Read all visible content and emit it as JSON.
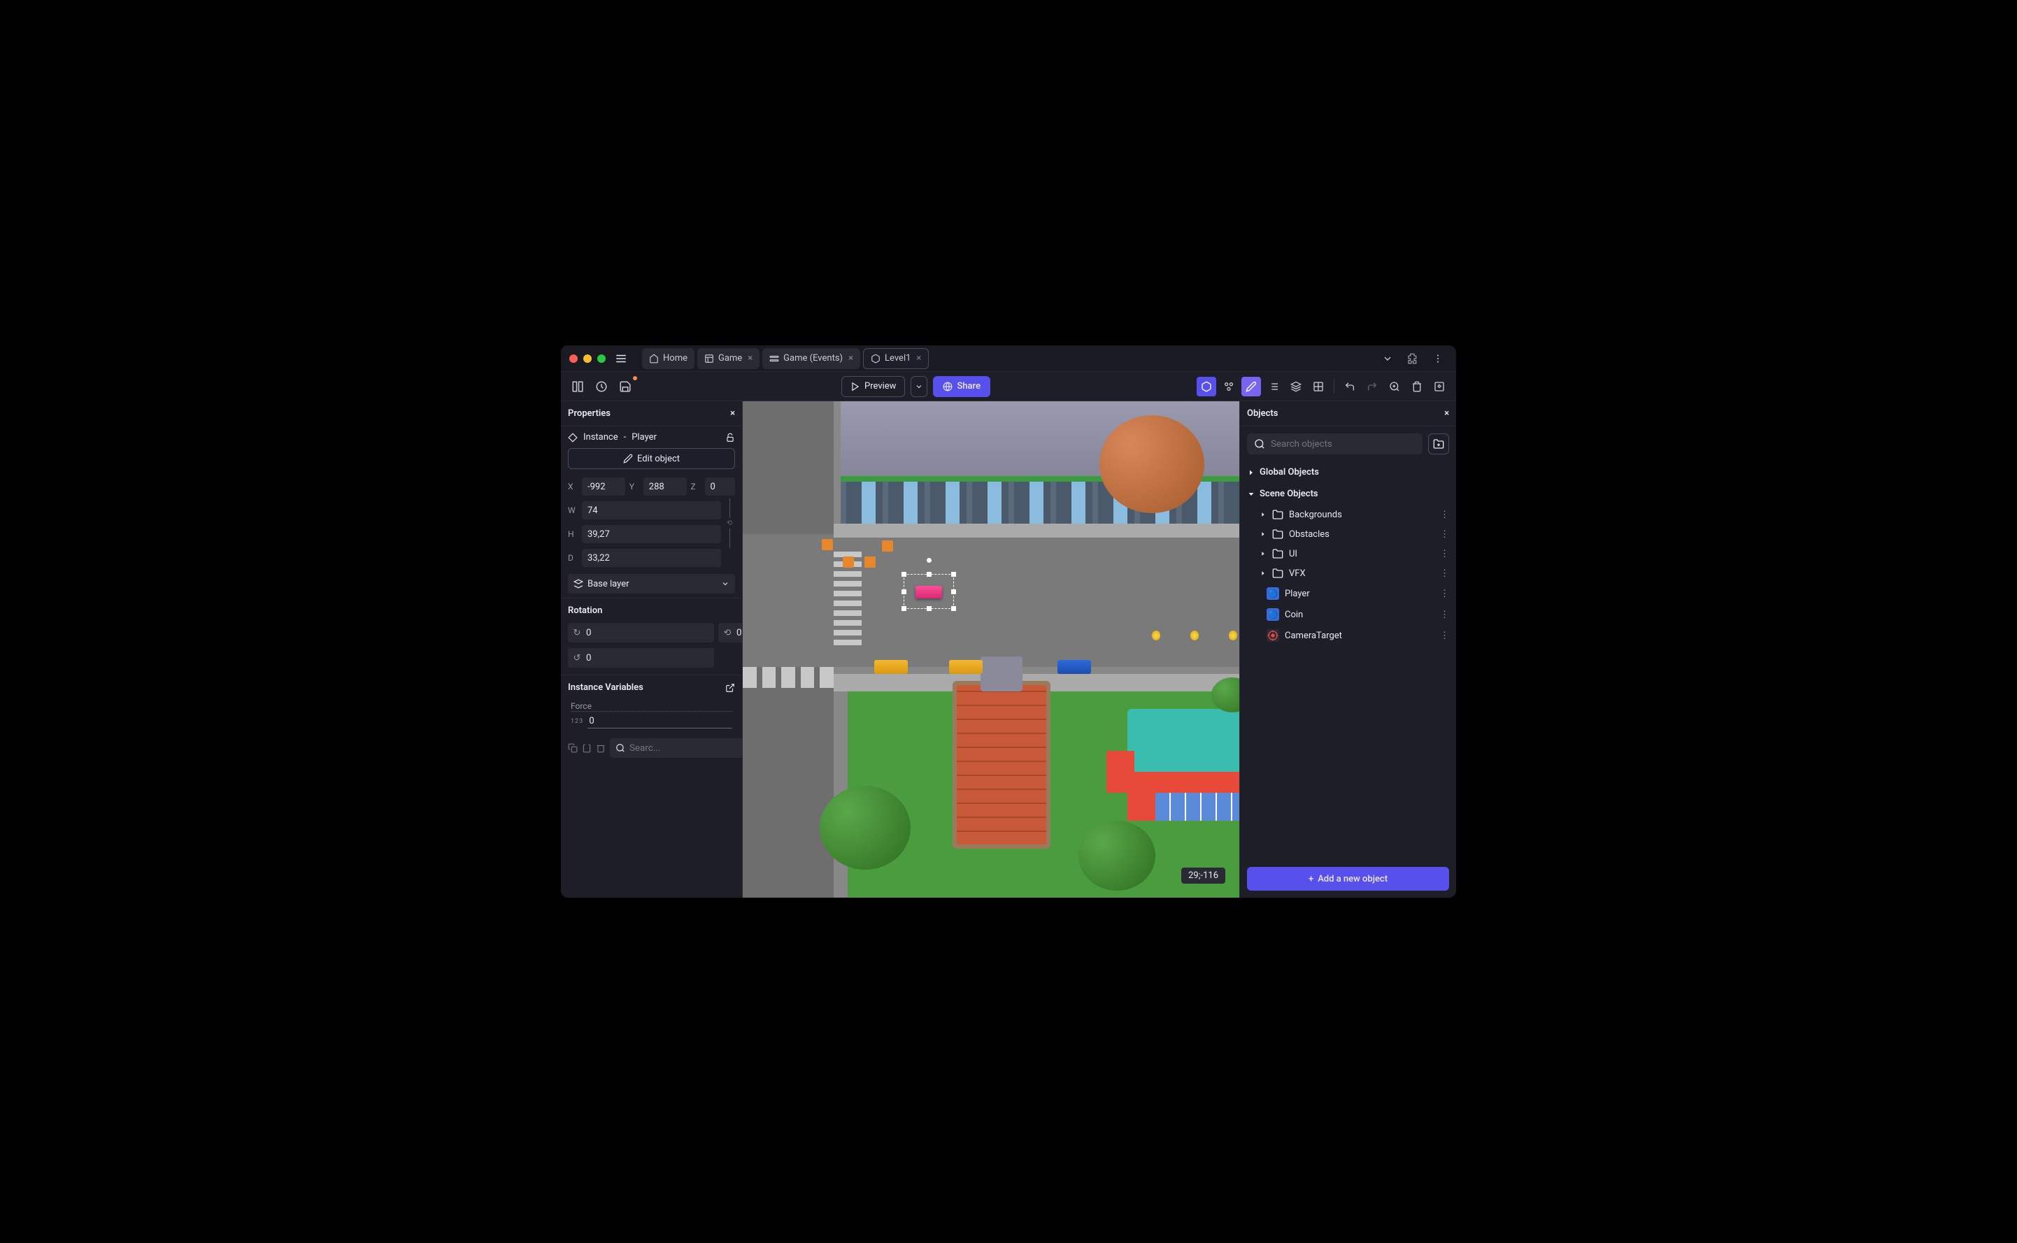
{
  "tabs": [
    {
      "label": "Home",
      "icon": "home"
    },
    {
      "label": "Game",
      "icon": "sheet",
      "closable": true
    },
    {
      "label": "Game (Events)",
      "icon": "events",
      "closable": true
    },
    {
      "label": "Level1",
      "icon": "scene",
      "closable": true,
      "active": true
    }
  ],
  "toolbar": {
    "preview_label": "Preview",
    "share_label": "Share"
  },
  "properties": {
    "panel_title": "Properties",
    "instance_label": "Instance",
    "instance_sep": "-",
    "instance_name": "Player",
    "edit_object_label": "Edit object",
    "x_label": "X",
    "x_value": "-992",
    "y_label": "Y",
    "y_value": "288",
    "z_label": "Z",
    "z_value": "0",
    "w_label": "W",
    "w_value": "74",
    "h_label": "H",
    "h_value": "39,27",
    "d_label": "D",
    "d_value": "33,22",
    "layer_label": "Base layer",
    "rotation_title": "Rotation",
    "rot_x": "0",
    "rot_y": "0",
    "rot_z": "0",
    "vars_title": "Instance Variables",
    "force_label": "Force",
    "force_type": "123",
    "force_value": "0",
    "search_placeholder": "Searc..."
  },
  "objects": {
    "panel_title": "Objects",
    "search_placeholder": "Search objects",
    "global_header": "Global Objects",
    "scene_header": "Scene Objects",
    "folders": [
      {
        "name": "Backgrounds"
      },
      {
        "name": "Obstacles"
      },
      {
        "name": "UI"
      },
      {
        "name": "VFX"
      }
    ],
    "items": [
      {
        "name": "Player",
        "icon": "player"
      },
      {
        "name": "Coin",
        "icon": "coin"
      },
      {
        "name": "CameraTarget",
        "icon": "target"
      }
    ],
    "add_button_label": "Add a new object"
  },
  "canvas": {
    "coords": "29;-116"
  }
}
